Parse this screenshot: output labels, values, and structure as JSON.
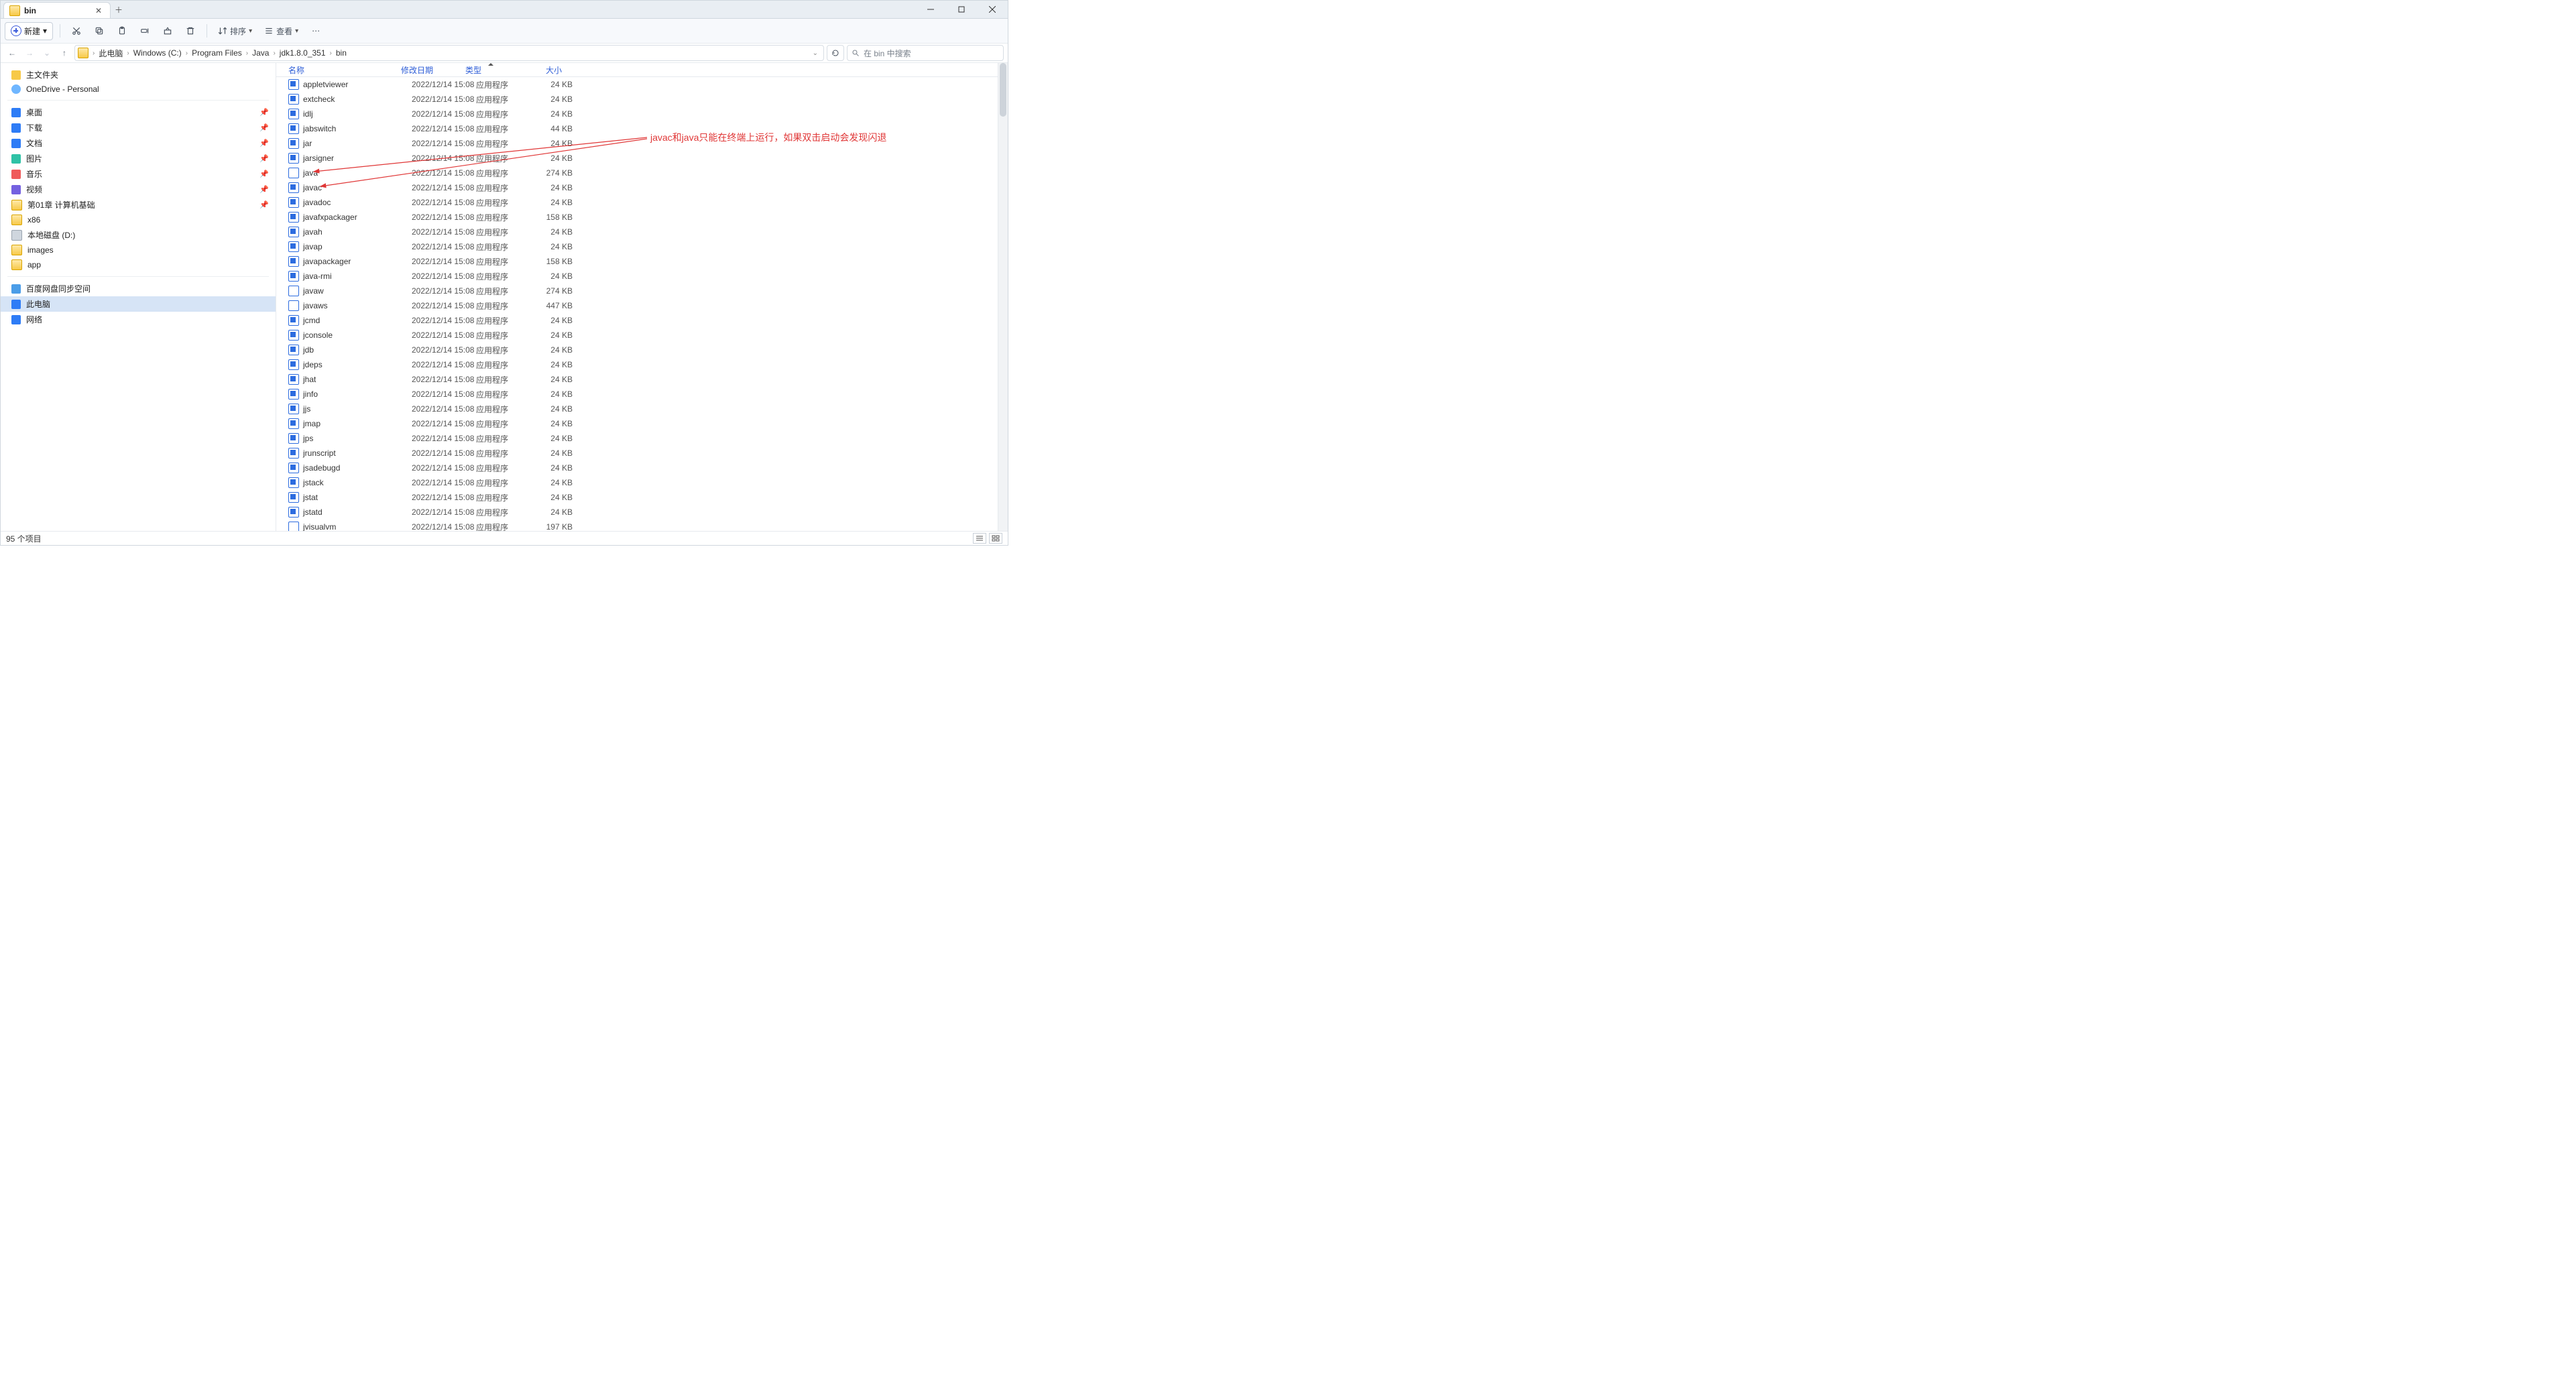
{
  "window": {
    "tab_title": "bin",
    "minimize_tooltip": "最小化",
    "maximize_tooltip": "还原",
    "close_tooltip": "关闭"
  },
  "toolbar": {
    "new_label": "新建",
    "sort_label": "排序",
    "view_label": "查看"
  },
  "breadcrumb": {
    "segments": [
      "此电脑",
      "Windows (C:)",
      "Program Files",
      "Java",
      "jdk1.8.0_351",
      "bin"
    ]
  },
  "search": {
    "placeholder": "在 bin 中搜索"
  },
  "sidebar": {
    "home": "主文件夹",
    "onedrive": "OneDrive - Personal",
    "quick": [
      {
        "icon": "desktop",
        "label": "桌面",
        "pinned": true
      },
      {
        "icon": "dl",
        "label": "下载",
        "pinned": true
      },
      {
        "icon": "doc",
        "label": "文档",
        "pinned": true
      },
      {
        "icon": "pic",
        "label": "图片",
        "pinned": true
      },
      {
        "icon": "music",
        "label": "音乐",
        "pinned": true
      },
      {
        "icon": "video",
        "label": "视频",
        "pinned": true
      },
      {
        "icon": "folder",
        "label": "第01章 计算机基础",
        "pinned": true
      },
      {
        "icon": "folder",
        "label": "x86",
        "pinned": false
      },
      {
        "icon": "drive",
        "label": "本地磁盘 (D:)",
        "pinned": false
      },
      {
        "icon": "folder",
        "label": "images",
        "pinned": false
      },
      {
        "icon": "folder",
        "label": "app",
        "pinned": false
      }
    ],
    "baidu": "百度网盘同步空间",
    "this_pc": "此电脑",
    "network": "网络"
  },
  "columns": {
    "name": "名称",
    "date": "修改日期",
    "type": "类型",
    "size": "大小"
  },
  "files": [
    {
      "name": "appletviewer",
      "date": "2022/12/14 15:08",
      "type": "应用程序",
      "size": "24 KB",
      "icon": "app"
    },
    {
      "name": "extcheck",
      "date": "2022/12/14 15:08",
      "type": "应用程序",
      "size": "24 KB",
      "icon": "app"
    },
    {
      "name": "idlj",
      "date": "2022/12/14 15:08",
      "type": "应用程序",
      "size": "24 KB",
      "icon": "app"
    },
    {
      "name": "jabswitch",
      "date": "2022/12/14 15:08",
      "type": "应用程序",
      "size": "44 KB",
      "icon": "app"
    },
    {
      "name": "jar",
      "date": "2022/12/14 15:08",
      "type": "应用程序",
      "size": "24 KB",
      "icon": "app"
    },
    {
      "name": "jarsigner",
      "date": "2022/12/14 15:08",
      "type": "应用程序",
      "size": "24 KB",
      "icon": "app"
    },
    {
      "name": "java",
      "date": "2022/12/14 15:08",
      "type": "应用程序",
      "size": "274 KB",
      "icon": "java"
    },
    {
      "name": "javac",
      "date": "2022/12/14 15:08",
      "type": "应用程序",
      "size": "24 KB",
      "icon": "app"
    },
    {
      "name": "javadoc",
      "date": "2022/12/14 15:08",
      "type": "应用程序",
      "size": "24 KB",
      "icon": "app"
    },
    {
      "name": "javafxpackager",
      "date": "2022/12/14 15:08",
      "type": "应用程序",
      "size": "158 KB",
      "icon": "app"
    },
    {
      "name": "javah",
      "date": "2022/12/14 15:08",
      "type": "应用程序",
      "size": "24 KB",
      "icon": "app"
    },
    {
      "name": "javap",
      "date": "2022/12/14 15:08",
      "type": "应用程序",
      "size": "24 KB",
      "icon": "app"
    },
    {
      "name": "javapackager",
      "date": "2022/12/14 15:08",
      "type": "应用程序",
      "size": "158 KB",
      "icon": "app"
    },
    {
      "name": "java-rmi",
      "date": "2022/12/14 15:08",
      "type": "应用程序",
      "size": "24 KB",
      "icon": "app"
    },
    {
      "name": "javaw",
      "date": "2022/12/14 15:08",
      "type": "应用程序",
      "size": "274 KB",
      "icon": "java"
    },
    {
      "name": "javaws",
      "date": "2022/12/14 15:08",
      "type": "应用程序",
      "size": "447 KB",
      "icon": "java"
    },
    {
      "name": "jcmd",
      "date": "2022/12/14 15:08",
      "type": "应用程序",
      "size": "24 KB",
      "icon": "app"
    },
    {
      "name": "jconsole",
      "date": "2022/12/14 15:08",
      "type": "应用程序",
      "size": "24 KB",
      "icon": "app"
    },
    {
      "name": "jdb",
      "date": "2022/12/14 15:08",
      "type": "应用程序",
      "size": "24 KB",
      "icon": "app"
    },
    {
      "name": "jdeps",
      "date": "2022/12/14 15:08",
      "type": "应用程序",
      "size": "24 KB",
      "icon": "app"
    },
    {
      "name": "jhat",
      "date": "2022/12/14 15:08",
      "type": "应用程序",
      "size": "24 KB",
      "icon": "app"
    },
    {
      "name": "jinfo",
      "date": "2022/12/14 15:08",
      "type": "应用程序",
      "size": "24 KB",
      "icon": "app"
    },
    {
      "name": "jjs",
      "date": "2022/12/14 15:08",
      "type": "应用程序",
      "size": "24 KB",
      "icon": "app"
    },
    {
      "name": "jmap",
      "date": "2022/12/14 15:08",
      "type": "应用程序",
      "size": "24 KB",
      "icon": "app"
    },
    {
      "name": "jps",
      "date": "2022/12/14 15:08",
      "type": "应用程序",
      "size": "24 KB",
      "icon": "app"
    },
    {
      "name": "jrunscript",
      "date": "2022/12/14 15:08",
      "type": "应用程序",
      "size": "24 KB",
      "icon": "app"
    },
    {
      "name": "jsadebugd",
      "date": "2022/12/14 15:08",
      "type": "应用程序",
      "size": "24 KB",
      "icon": "app"
    },
    {
      "name": "jstack",
      "date": "2022/12/14 15:08",
      "type": "应用程序",
      "size": "24 KB",
      "icon": "app"
    },
    {
      "name": "jstat",
      "date": "2022/12/14 15:08",
      "type": "应用程序",
      "size": "24 KB",
      "icon": "app"
    },
    {
      "name": "jstatd",
      "date": "2022/12/14 15:08",
      "type": "应用程序",
      "size": "24 KB",
      "icon": "app"
    },
    {
      "name": "jvisualvm",
      "date": "2022/12/14 15:08",
      "type": "应用程序",
      "size": "197 KB",
      "icon": "jvisual"
    }
  ],
  "status": {
    "count_label": "95 个项目"
  },
  "annotation": {
    "text": "javac和java只能在终端上运行，如果双击启动会发现闪退"
  }
}
